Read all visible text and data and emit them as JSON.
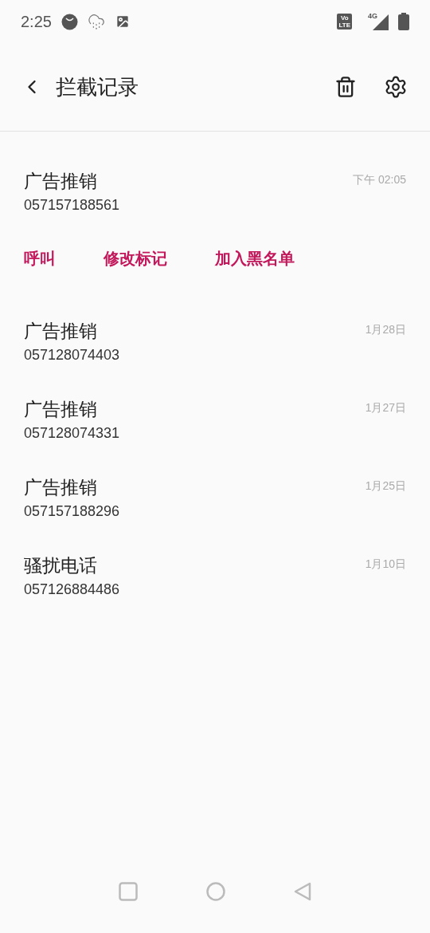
{
  "status_bar": {
    "time": "2:25",
    "volte": [
      "Vo",
      "LTE"
    ],
    "network": "4G"
  },
  "app_bar": {
    "title": "拦截记录"
  },
  "records": [
    {
      "label": "广告推销",
      "number": "057157188561",
      "date": "下午 02:05",
      "expanded": true,
      "actions": [
        "呼叫",
        "修改标记",
        "加入黑名单"
      ]
    },
    {
      "label": "广告推销",
      "number": "057128074403",
      "date": "1月28日",
      "expanded": false
    },
    {
      "label": "广告推销",
      "number": "057128074331",
      "date": "1月27日",
      "expanded": false
    },
    {
      "label": "广告推销",
      "number": "057157188296",
      "date": "1月25日",
      "expanded": false
    },
    {
      "label": "骚扰电话",
      "number": "057126884486",
      "date": "1月10日",
      "expanded": false
    }
  ]
}
